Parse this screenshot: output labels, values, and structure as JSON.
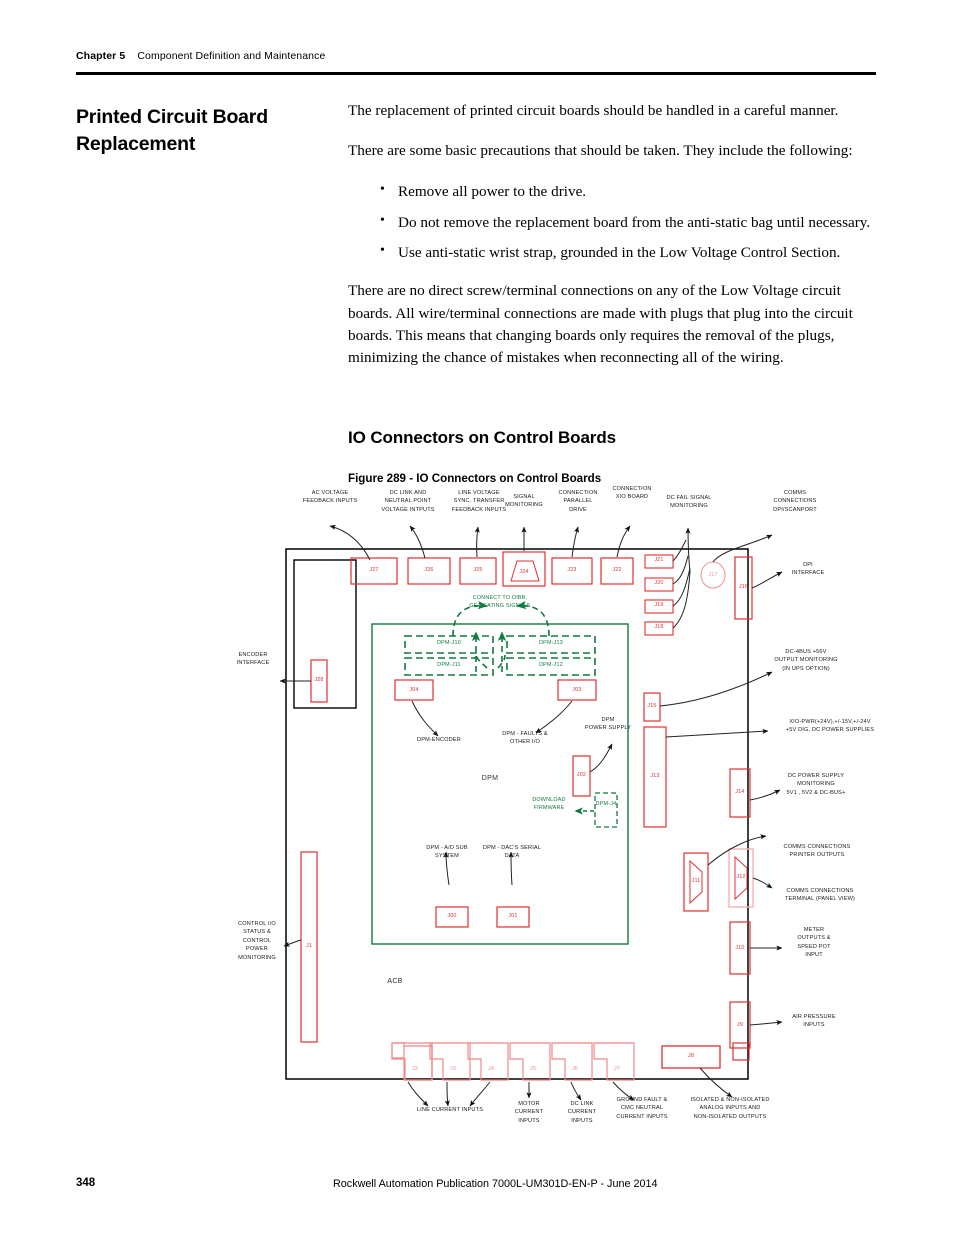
{
  "header": {
    "chapter": "Chapter 5",
    "chapter_title": "Component Definition and Maintenance"
  },
  "side_title": "Printed Circuit Board Replacement",
  "body": {
    "p1": "The replacement of printed circuit boards should be handled in a careful manner.",
    "p2": "There are some basic precautions that should be taken. They include the following:",
    "bullets": [
      "Remove all power to the drive.",
      "Do not remove the replacement board from the anti-static bag until necessary.",
      "Use anti-static wrist strap, grounded in the Low Voltage Control Section."
    ],
    "p3": "There are no direct screw/terminal connections on any of the Low Voltage circuit boards. All wire/terminal connections are made with plugs that plug into the circuit boards. This means that changing boards only requires the removal of the plugs, minimizing the chance of mistakes when reconnecting all of the wiring."
  },
  "section_heading": "IO Connectors on Control Boards",
  "figure_caption": "Figure 289 - IO Connectors on Control Boards",
  "figure": {
    "board_label": "ACB",
    "inner_board_label": "DPM",
    "top_annotations": [
      {
        "text": "AC VOLTAGE\nFEEDBACK INPUTS",
        "connector": "J27"
      },
      {
        "text": "DC LINK AND\nNEUTRAL POINT\nVOLTAGE INTPUTS",
        "connector": "J26"
      },
      {
        "text": "LINE VOLTAGE\nSYNC. TRANSFER\nFEEDBACK INPUTS",
        "connector": "J25"
      },
      {
        "text": "SIGNAL\nMONITORING",
        "connector": "J24"
      },
      {
        "text": "CONNECTION\nPARALLEL\nDRIVE",
        "connector": "J23"
      },
      {
        "text": "CONNECTION\nXIO BOARD",
        "connector": "J22"
      },
      {
        "text": "DC FAIL SIGNAL\nMONITORING",
        "connector": "J21"
      },
      {
        "text": "COMMS\nCONNECTIONS\nDPI/SCANPORT",
        "connector": "J17"
      }
    ],
    "top_extra_connectors": [
      "J20",
      "J19",
      "J18"
    ],
    "right_annotations": [
      {
        "text": "DPI\nINTERFACE",
        "connector": "J16"
      },
      {
        "text": "DC-4BUS +56V\nOUTPUT MONITORING\n(IN UPS OPTION)",
        "connector": "J15"
      },
      {
        "text": "XIO-PWR(+24V),+/-15V,+/-24V\n+5V DIG, DC POWER SUPPLIES",
        "connector": "J13"
      },
      {
        "text": "DC POWER SUPPLY\nMONITORING\n5V1 , 5V2 & DC-BUS+",
        "connector": "J14"
      },
      {
        "text": "COMMS CONNECTIONS\nPRINTER OUTPUTS",
        "connector": "J11"
      },
      {
        "text": "COMMS CONNECTIONS\nTERMINAL (PANEL VIEW)",
        "connector": "J12"
      },
      {
        "text": "METER\nOUTPUTS &\nSPEED POT\nINPUT",
        "connector": "J10"
      },
      {
        "text": "AIR PRESSURE\nINPUTS",
        "connector": "J9"
      }
    ],
    "left_annotations": [
      {
        "text": "ENCODER\nINTERFACE",
        "connector": "J28"
      },
      {
        "text": "CONTROL I/O\nSTATUS &\nCONTROL\nPOWER\nMONITORING",
        "connector": "J1"
      }
    ],
    "bottom_annotations": [
      {
        "text": "LINE CURRENT INPUTS",
        "connectors": [
          "J2",
          "J3",
          "J4"
        ]
      },
      {
        "text": "MOTOR\nCURRENT\nINPUTS",
        "connectors": [
          "J5"
        ]
      },
      {
        "text": "DC LINK\nCURRENT\nINPUTS",
        "connectors": [
          "J6"
        ]
      },
      {
        "text": "GROUND FAULT &\nCMC NEUTRAL\nCURRENT INPUTS",
        "connectors": [
          "J7"
        ]
      },
      {
        "text": "ISOLATED & NON-ISOLATED\nANALOG INPUTS AND\nNON-ISOLATED OUTPUTS",
        "connectors": [
          "J8"
        ]
      }
    ],
    "dpm": {
      "gating_note": "CONNECT TO OIBB,\nGET GATING SIGNALS",
      "gating_ports": [
        "DPM-J10",
        "DPM-J11",
        "DPM-J13",
        "DPM-J12"
      ],
      "annotations": [
        {
          "text": "DPM-ENCODER",
          "connector": "J04"
        },
        {
          "text": "DPM - FAULTS &\nOTHER I/O",
          "connector": "J03"
        },
        {
          "text": "DPM\nPOWER SUPPLY",
          "connector": "J02"
        },
        {
          "text": "DOWNLOAD\nFIRMWARE",
          "connector": "DPM-J4"
        },
        {
          "text": "DPM - A/D SUB\nSYSTEM",
          "connector": "J00"
        },
        {
          "text": "DPM - DAC'S SERIAL\nDATA",
          "connector": "J01"
        }
      ]
    }
  },
  "footer": {
    "page_number": "348",
    "publication": "Rockwell Automation Publication 7000L-UM301D-EN-P - June 2014"
  },
  "colors": {
    "connector_red": "#e03030",
    "dpm_green": "#0f7b3e",
    "board_outline": "#000000"
  }
}
